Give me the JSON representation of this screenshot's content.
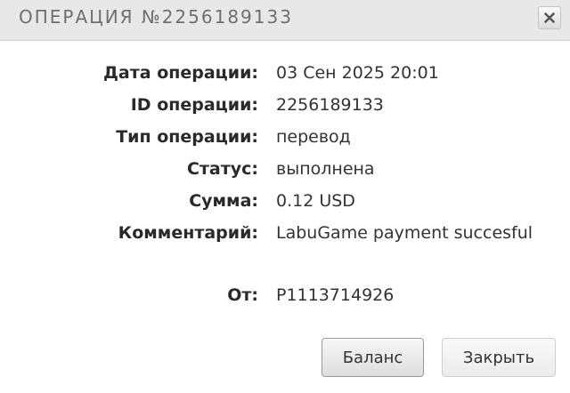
{
  "dialog": {
    "title": "ОПЕРАЦИЯ №2256189133",
    "close_icon": "close-x-icon"
  },
  "details": [
    {
      "label": "Дата операции:",
      "value": "03 Сен 2025 20:01"
    },
    {
      "label": "ID операции:",
      "value": "2256189133"
    },
    {
      "label": "Тип операции:",
      "value": "перевод"
    },
    {
      "label": "Статус:",
      "value": "выполнена"
    },
    {
      "label": "Сумма:",
      "value": "0.12 USD"
    },
    {
      "label": "Комментарий:",
      "value": "LabuGame payment succesful"
    }
  ],
  "from": {
    "label": "От:",
    "value": "P1113714926"
  },
  "buttons": {
    "balance_label": "Баланс",
    "close_label": "Закрыть"
  }
}
